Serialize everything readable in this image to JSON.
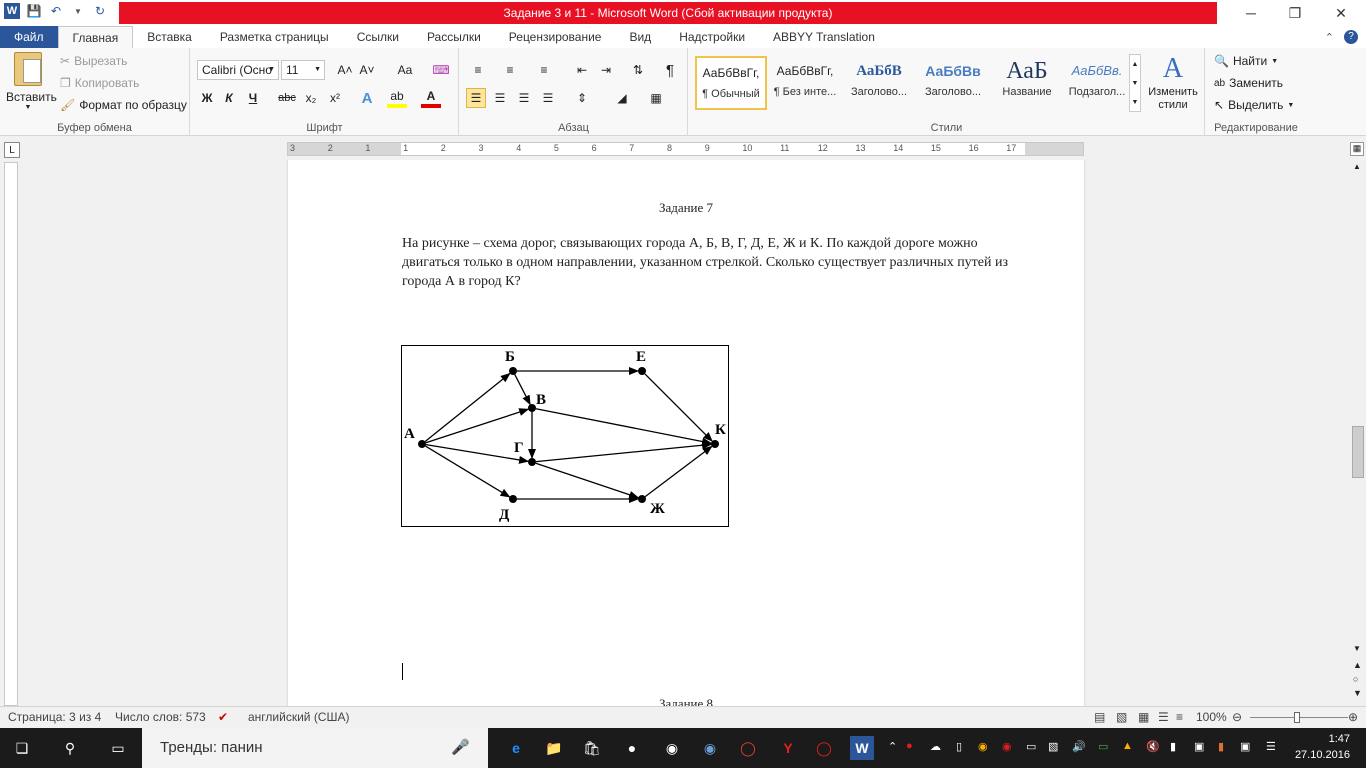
{
  "window": {
    "title": "Задание 3 и 11  -  Microsoft Word (Сбой активации продукта)",
    "minimize": "─",
    "maximize": "❐",
    "close": "✕"
  },
  "tabs": [
    "Файл",
    "Главная",
    "Вставка",
    "Разметка страницы",
    "Ссылки",
    "Рассылки",
    "Рецензирование",
    "Вид",
    "Надстройки",
    "ABBYY Translation"
  ],
  "clipboard": {
    "paste": "Вставить",
    "cut": "Вырезать",
    "copy": "Копировать",
    "format_painter": "Формат по образцу",
    "label": "Буфер обмена"
  },
  "font": {
    "name": "Calibri (Осно",
    "size": "11",
    "label": "Шрифт",
    "bold": "Ж",
    "italic": "К",
    "underline": "Ч",
    "strike": "abc",
    "sub": "x₂",
    "sup": "x²",
    "grow": "A˄",
    "shrink": "A˅",
    "case": "Aa",
    "text_effect": "A",
    "highlight": "ab",
    "color": "A"
  },
  "paragraph": {
    "label": "Абзац",
    "pilcrow": "¶"
  },
  "styles": {
    "label": "Стили",
    "items": [
      {
        "sample": "АаБбВвГг,",
        "name": "¶ Обычный"
      },
      {
        "sample": "АаБбВвГг,",
        "name": "¶ Без инте..."
      },
      {
        "sample": "АаБбВ",
        "name": "Заголово..."
      },
      {
        "sample": "АаБбВв",
        "name": "Заголово..."
      },
      {
        "sample": "АаБ",
        "name": "Название"
      },
      {
        "sample": "АаБбВв.",
        "name": "Подзагол..."
      }
    ],
    "change": "Изменить стили"
  },
  "editing": {
    "find": "Найти",
    "replace": "Заменить",
    "select": "Выделить",
    "label": "Редактирование"
  },
  "ruler_numbers": [
    "3",
    "2",
    "1",
    "1",
    "2",
    "3",
    "4",
    "5",
    "6",
    "7",
    "8",
    "9",
    "10",
    "11",
    "12",
    "13",
    "14",
    "15",
    "16",
    "17"
  ],
  "document": {
    "heading": "Задание 7",
    "paragraph": "На рисунке – схема дорог, связывающих города А, Б, В, Г, Д, Е, Ж и К. По каждой дороге можно двигаться только в одном направлении, указанном стрелкой. Сколько существует различных путей из города А в город К?",
    "next_heading": "Задание 8"
  },
  "graph": {
    "nodes": [
      {
        "id": "А",
        "label": "А"
      },
      {
        "id": "Б",
        "label": "Б"
      },
      {
        "id": "В",
        "label": "В"
      },
      {
        "id": "Г",
        "label": "Г"
      },
      {
        "id": "Д",
        "label": "Д"
      },
      {
        "id": "Е",
        "label": "Е"
      },
      {
        "id": "Ж",
        "label": "Ж"
      },
      {
        "id": "К",
        "label": "К"
      }
    ],
    "edges": [
      [
        "А",
        "Б"
      ],
      [
        "А",
        "В"
      ],
      [
        "А",
        "Г"
      ],
      [
        "А",
        "Д"
      ],
      [
        "Б",
        "Е"
      ],
      [
        "Б",
        "В"
      ],
      [
        "В",
        "Г"
      ],
      [
        "В",
        "К"
      ],
      [
        "Г",
        "К"
      ],
      [
        "Г",
        "Ж"
      ],
      [
        "Д",
        "Ж"
      ],
      [
        "Е",
        "К"
      ],
      [
        "Ж",
        "К"
      ]
    ]
  },
  "status": {
    "page": "Страница: 3 из 4",
    "words": "Число слов: 573",
    "language": "английский (США)",
    "zoom": "100%"
  },
  "taskbar": {
    "search": "Тренды: панин",
    "time": "1:47",
    "date": "27.10.2016"
  }
}
